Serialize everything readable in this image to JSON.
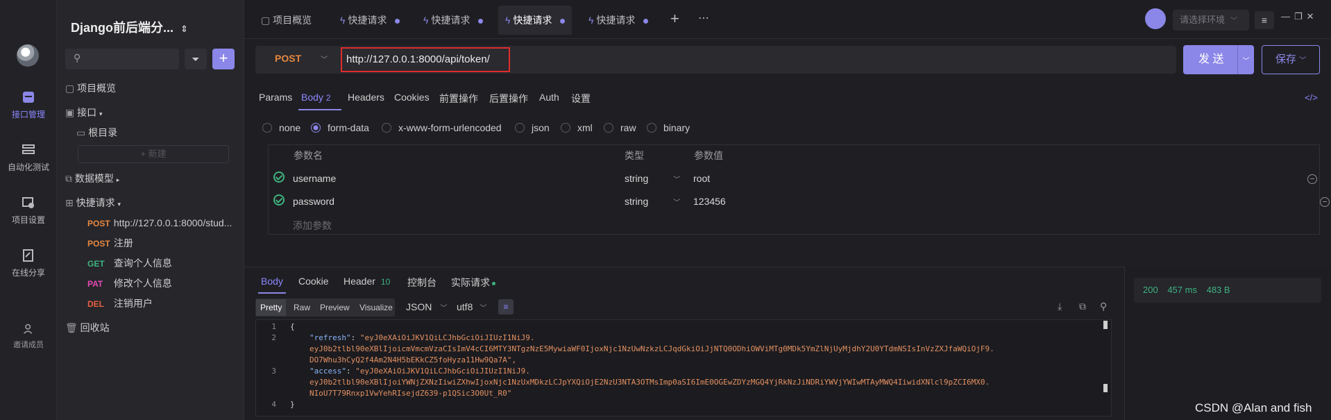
{
  "rail": {
    "items": [
      {
        "label": "接口管理"
      },
      {
        "label": "自动化测试"
      },
      {
        "label": "项目设置"
      },
      {
        "label": "在线分享"
      },
      {
        "label": "邀请成员"
      }
    ]
  },
  "sidebar": {
    "project_title": "Django前后端分...",
    "search_placeholder": "",
    "tree": {
      "overview": "项目概览",
      "apis": "接口",
      "root": "根目录",
      "new": "+ 新建",
      "models": "数据模型",
      "quick": "快捷请求",
      "requests": [
        {
          "method": "POST",
          "name": "http://127.0.0.1:8000/stud..."
        },
        {
          "method": "POST",
          "name": "注册"
        },
        {
          "method": "GET",
          "name": "查询个人信息"
        },
        {
          "method": "PAT",
          "name": "修改个人信息"
        },
        {
          "method": "DEL",
          "name": "注销用户"
        }
      ],
      "trash": "回收站"
    }
  },
  "tabs": [
    {
      "label": "项目概览"
    },
    {
      "label": "快捷请求"
    },
    {
      "label": "快捷请求"
    },
    {
      "label": "快捷请求"
    },
    {
      "label": "快捷请求"
    }
  ],
  "env": {
    "placeholder": "请选择环境"
  },
  "request": {
    "method": "POST",
    "url": "http://127.0.0.1:8000/api/token/",
    "send": "发 送",
    "save": "保存",
    "tabs": [
      {
        "label": "Params"
      },
      {
        "label": "Body",
        "badge": "2"
      },
      {
        "label": "Headers"
      },
      {
        "label": "Cookies"
      },
      {
        "label": "前置操作"
      },
      {
        "label": "后置操作"
      },
      {
        "label": "Auth"
      },
      {
        "label": "设置"
      }
    ],
    "body_types": [
      "none",
      "form-data",
      "x-www-form-urlencoded",
      "json",
      "xml",
      "raw",
      "binary"
    ],
    "params_headers": {
      "name": "参数名",
      "type": "类型",
      "value": "参数值"
    },
    "params": [
      {
        "name": "username",
        "type": "string",
        "value": "root"
      },
      {
        "name": "password",
        "type": "string",
        "value": "123456"
      }
    ],
    "add_param": "添加参数"
  },
  "response": {
    "tabs": [
      {
        "label": "Body"
      },
      {
        "label": "Cookie"
      },
      {
        "label": "Header",
        "badge": "10"
      },
      {
        "label": "控制台"
      },
      {
        "label": "实际请求"
      }
    ],
    "formats": [
      "Pretty",
      "Raw",
      "Preview",
      "Visualize"
    ],
    "lang": "JSON",
    "encoding": "utf8",
    "lines": [
      {
        "n": "1",
        "text": "{"
      },
      {
        "n": "2",
        "key": "\"refresh\"",
        "val": "\"eyJ0eXAiOiJKV1QiLCJhbGciOiJIUzI1NiJ9."
      },
      {
        "n": "",
        "val": "eyJ0b2tlbl90eXBlIjoicmVmcmVzaCIsImV4cCI6MTY3NTgzNzE5MywiaWF0IjoxNjc1NzUwNzkzLCJqdGkiOiJjNTQ0ODhiOWViMTg0MDk5YmZlNjUyMjdhY2U0YTdmNSIsInVzZXJfaWQiOjF9."
      },
      {
        "n": "",
        "val": "DO7Whu3hCyQ2f4Am2N4H5bEKkCZ5foHyza11Hw9Qa7A\","
      },
      {
        "n": "3",
        "key": "\"access\"",
        "val": "\"eyJ0eXAiOiJKV1QiLCJhbGciOiJIUzI1NiJ9."
      },
      {
        "n": "",
        "val": "eyJ0b2tlbl90eXBlIjoiYWNjZXNzIiwiZXhwIjoxNjc1NzUxMDkzLCJpYXQiOjE2NzU3NTA3OTMsImp0aSI6ImE0OGEwZDYzMGQ4YjRkNzJiNDRiYWVjYWIwMTAyMWQ4IiwidXNlcl9pZCI6MX0."
      },
      {
        "n": "",
        "val": "NIoU7T79Rnxp1VwYehRIsejdZ639-p1QSic3O0Ut_R0\""
      },
      {
        "n": "4",
        "text": "}"
      }
    ],
    "status": {
      "code": "200",
      "time": "457 ms",
      "size": "483 B"
    }
  },
  "watermark": "CSDN @Alan and fish"
}
